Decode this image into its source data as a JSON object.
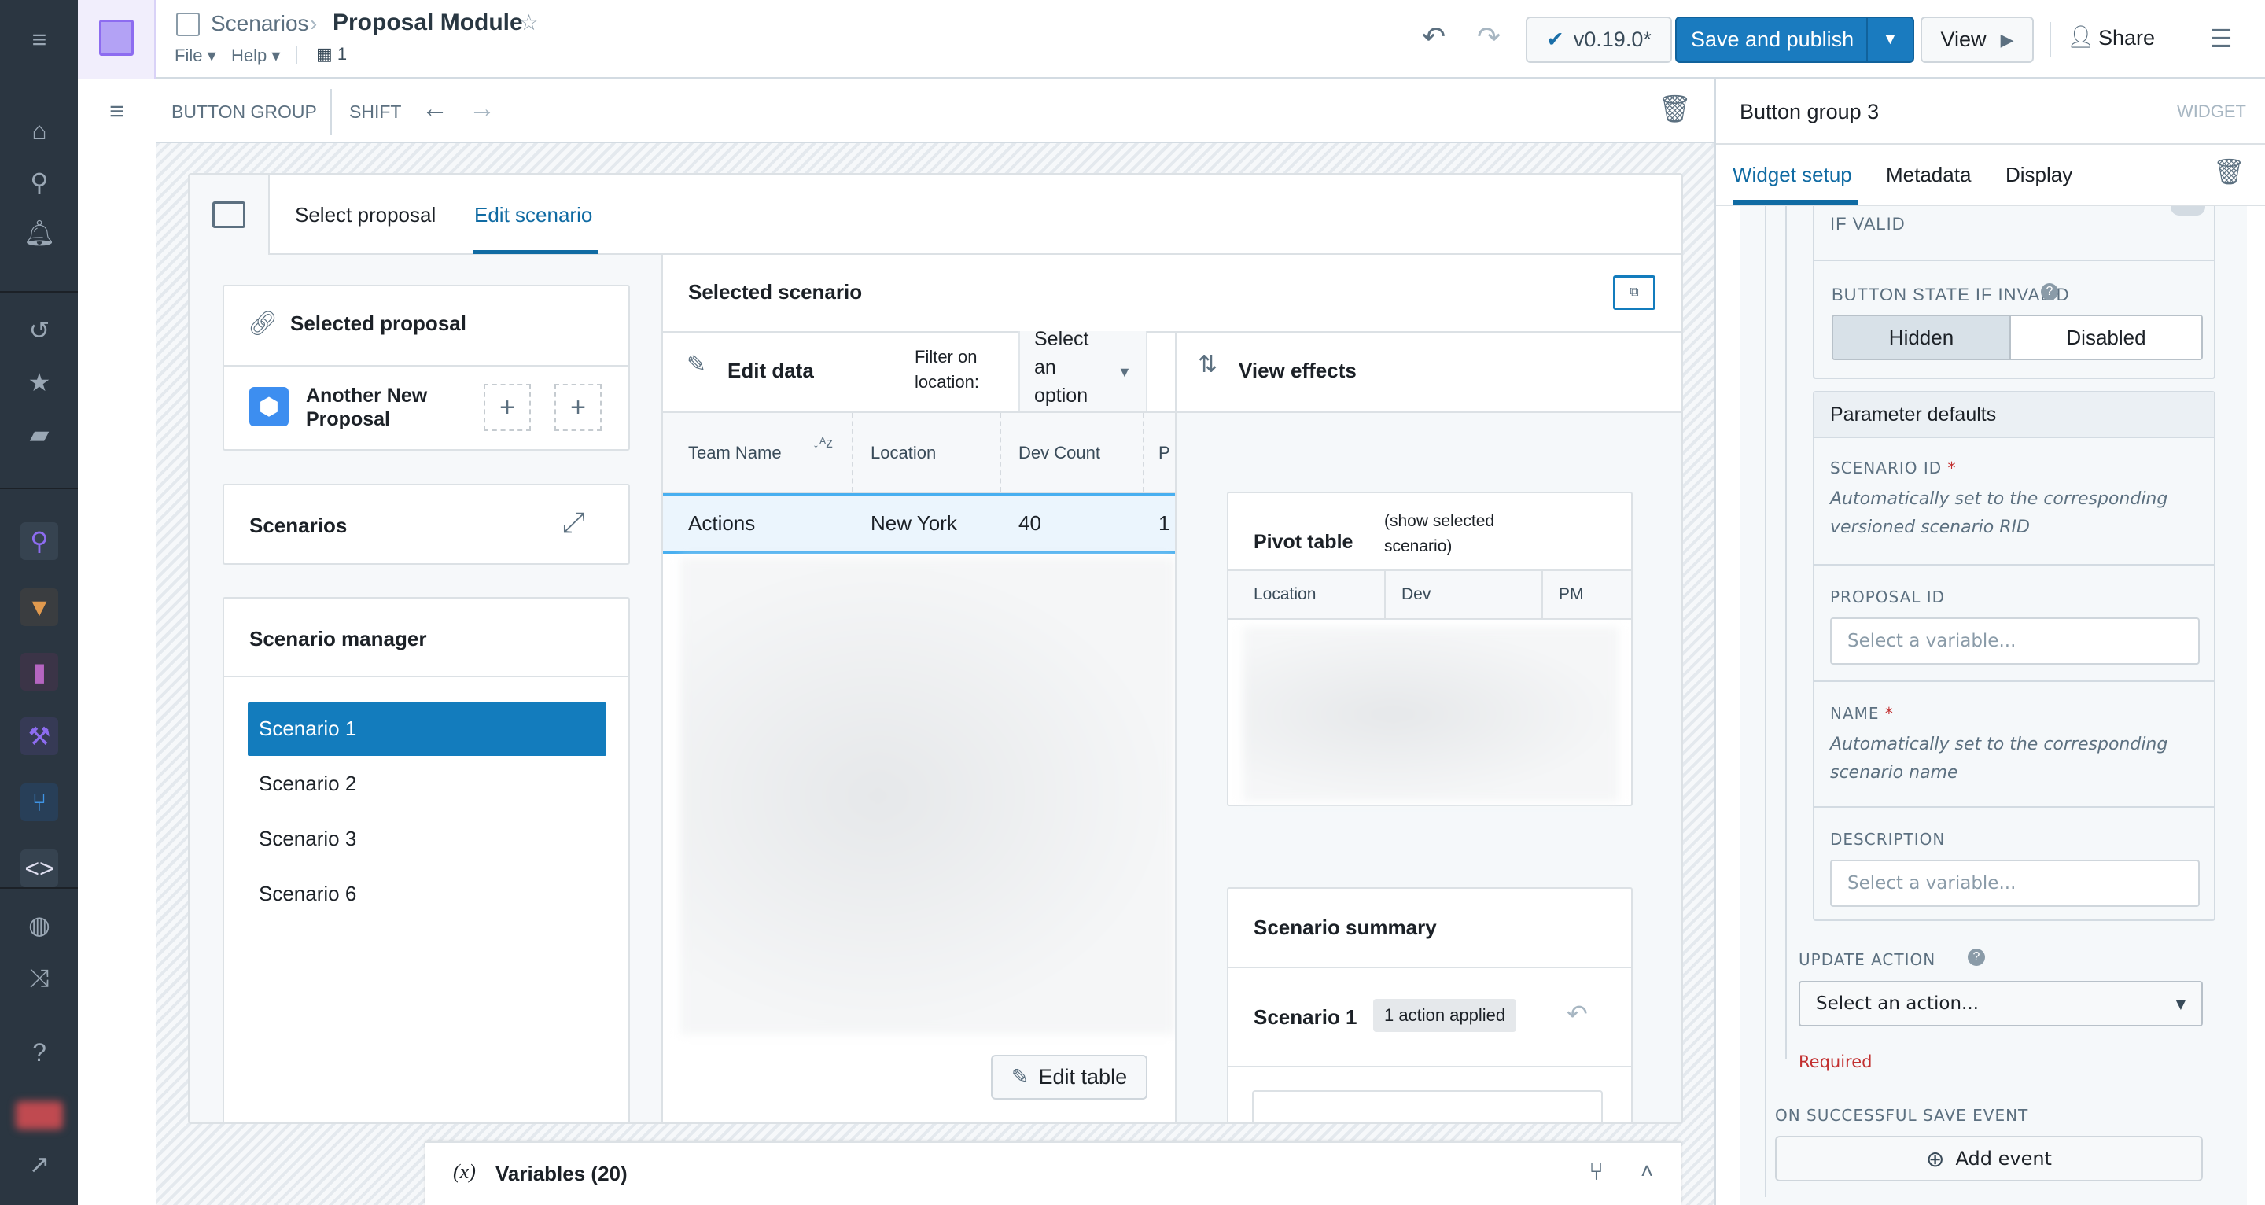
{
  "nav": {
    "icons": [
      "menu-expand-icon",
      "home-icon",
      "search-icon",
      "notifications-icon",
      "history-icon",
      "favorites-icon",
      "folder-icon",
      "object-explorer-icon",
      "contour-icon",
      "quiver-icon",
      "pipeline-builder-icon",
      "ontology-icon",
      "workshop-icon",
      "globe-icon",
      "shuffle-icon",
      "help-icon",
      "avatar",
      "external-link-icon"
    ]
  },
  "header": {
    "breadcrumb_parent": "Scenarios",
    "title": "Proposal Module",
    "file_menu": "File",
    "help_menu": "Help",
    "org_count": "1",
    "version": "v0.19.0*",
    "save_publish": "Save and publish",
    "view": "View",
    "share": "Share"
  },
  "toolbar": {
    "widget_type": "BUTTON GROUP",
    "shift_label": "SHIFT"
  },
  "card": {
    "tabs": [
      "Select proposal",
      "Edit scenario"
    ],
    "active_tab": "Edit scenario"
  },
  "left": {
    "selected_proposal_title": "Selected proposal",
    "proposal_name": "Another New Proposal",
    "scenarios_title": "Scenarios",
    "manager_title": "Scenario manager",
    "scenarios": [
      "Scenario 1",
      "Scenario 2",
      "Scenario 3",
      "Scenario 6"
    ],
    "selected_scenario": "Scenario 1"
  },
  "middle": {
    "title": "Selected scenario",
    "edit_data": "Edit data",
    "filter_label": "Filter on location:",
    "filter_value": "Select an option",
    "columns": [
      "Team Name",
      "Location",
      "Dev Count",
      "P"
    ],
    "rows": [
      [
        "Actions",
        "New York",
        "40",
        "1"
      ]
    ],
    "edit_table": "Edit table"
  },
  "effects": {
    "title": "View effects",
    "pivot_title": "Pivot table",
    "pivot_subtitle": "(show selected scenario)",
    "pivot_columns": [
      "Location",
      "Dev",
      "PM"
    ],
    "summary_title": "Scenario summary",
    "summary_scenario": "Scenario 1",
    "summary_badge": "1 action applied"
  },
  "variables": {
    "icon": "(x)",
    "label": "Variables (20)"
  },
  "panel": {
    "title": "Button group 3",
    "kind": "WIDGET",
    "tabs": [
      "Widget setup",
      "Metadata",
      "Display"
    ],
    "active_tab": "Widget setup",
    "if_valid": "IF VALID",
    "button_state_label": "BUTTON STATE IF INVALID",
    "button_state_options": [
      "Hidden",
      "Disabled"
    ],
    "button_state_selected": "Hidden",
    "param_defaults": "Parameter defaults",
    "scenario_id_label": "SCENARIO ID",
    "scenario_id_note": "Automatically set to the corresponding versioned scenario RID",
    "proposal_id_label": "PROPOSAL ID",
    "proposal_id_placeholder": "Select a variable...",
    "name_label": "NAME",
    "name_note": "Automatically set to the corresponding scenario name",
    "description_label": "DESCRIPTION",
    "description_placeholder": "Select a variable...",
    "required_mark": "*",
    "update_action_label": "UPDATE ACTION",
    "update_action_value": "Select an action...",
    "required_text": "Required",
    "save_event_label": "ON SUCCESSFUL SAVE EVENT",
    "add_event": "Add event"
  },
  "colors": {
    "primary": "#1a7bbf",
    "nav_bg": "#2b3641",
    "selected_row": "#137cbd",
    "error": "#c23030"
  }
}
